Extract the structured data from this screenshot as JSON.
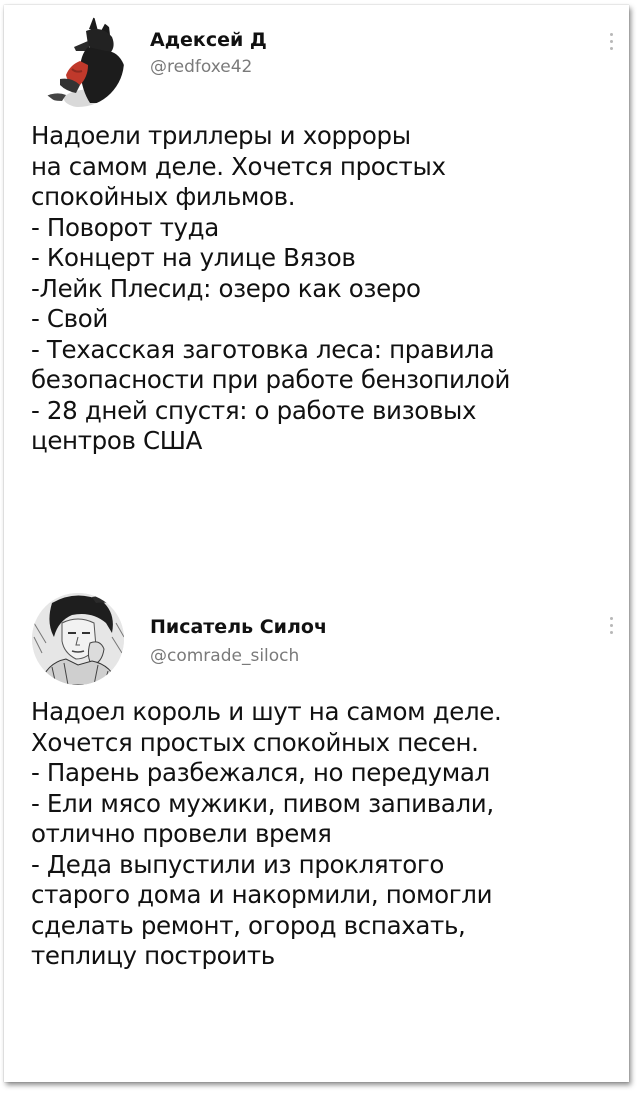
{
  "tweets": [
    {
      "author_name": "Адексей Д",
      "handle": "@redfoxe42",
      "lines": [
        "Надоели триллеры и хорроры",
        "на самом деле. Хочется простых",
        "спокойных фильмов.",
        "- Поворот туда",
        "- Концерт на улице Вязов",
        "-Лейк Плесид: озеро как озеро",
        "- Свой",
        "- Техасская заготовка леса: правила",
        "безопасности при работе бензопилой",
        "- 28 дней спустя: о работе визовых",
        "центров США"
      ]
    },
    {
      "author_name": "Писатель Силоч",
      "handle": "@comrade_siloch",
      "lines": [
        "Надоел король и шут на самом деле.",
        "Хочется простых спокойных песен.",
        "- Парень разбежался, но передумал",
        "- Ели мясо мужики, пивом запивали,",
        "отлично провели время",
        "- Деда выпустили из проклятого",
        "старого дома и накормили, помогли",
        "сделать ремонт, огород вспахать,",
        "теплицу построить"
      ]
    }
  ],
  "icons": {
    "more": "more-vertical-icon",
    "avatar1": "dog-with-red-jacket-avatar",
    "avatar2": "sketch-portrait-avatar"
  },
  "colors": {
    "text": "#111111",
    "handle": "#7a7a7a",
    "more_dots": "#b8b8b8"
  }
}
